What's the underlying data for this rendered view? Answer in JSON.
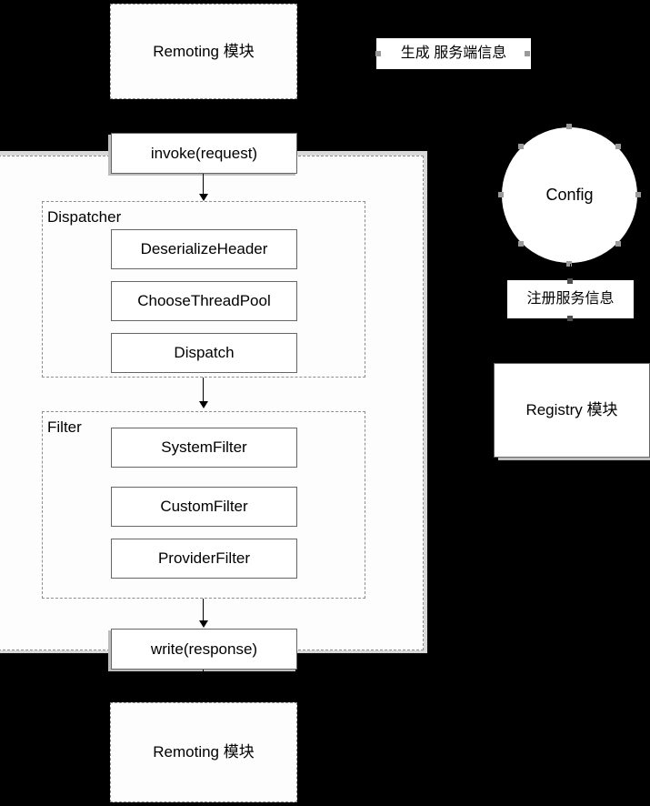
{
  "diagram": {
    "title_top": "Remoting 模块",
    "title_bottom": "Remoting 模块",
    "entry_call": "invoke(request)",
    "exit_call": "write(response)",
    "groups": {
      "dispatcher_label": "Dispatcher",
      "filter_label": "Filter"
    },
    "dispatcher_steps": [
      "DeserializeHeader",
      "ChooseThreadPool",
      "Dispatch"
    ],
    "filter_steps": [
      "SystemFilter",
      "CustomFilter",
      "ProviderFilter"
    ],
    "right_column": {
      "generate_label": "生成 服务端信息",
      "config_node": "Config",
      "register_label": "注册服务信息",
      "registry_module": "Registry 模块"
    },
    "colors": {
      "background": "#000000",
      "node_fill": "#ffffff",
      "node_stroke": "#666666",
      "dashed_stroke": "#8e8e8e",
      "selection_handle": "#9a9a9a",
      "group_fill": "#fdfdfd",
      "text": "#000000"
    }
  }
}
